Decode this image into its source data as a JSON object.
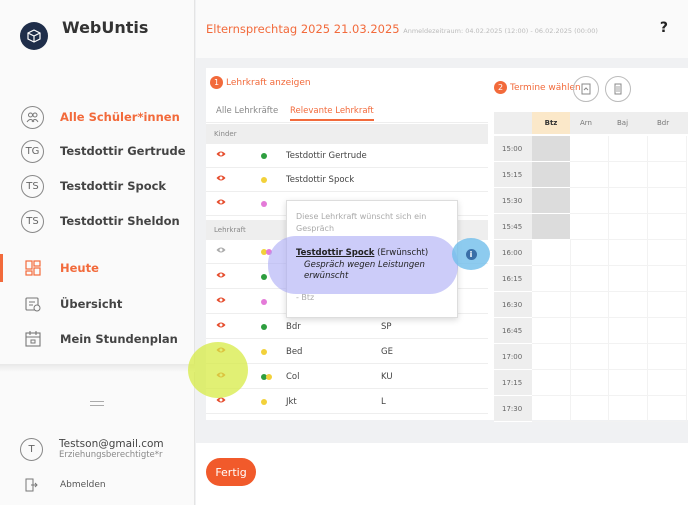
{
  "app": {
    "name": "WebUntis"
  },
  "sidebar": {
    "items": [
      {
        "label": "Alle Schüler*innen",
        "icon": "students-icon"
      },
      {
        "label": "Testdottir Gertrude",
        "initials": "TG"
      },
      {
        "label": "Testdottir Spock",
        "initials": "TS"
      },
      {
        "label": "Testdottir Sheldon",
        "initials": "TS"
      },
      {
        "label": "Heute",
        "icon": "dashboard-icon"
      },
      {
        "label": "Übersicht",
        "icon": "overview-icon"
      },
      {
        "label": "Mein Stundenplan",
        "icon": "calendar-icon"
      }
    ],
    "user": {
      "initial": "T",
      "email": "Testson@gmail.com",
      "role": "Erziehungsberechtigte*r"
    },
    "logout": "Abmelden"
  },
  "header": {
    "title": "Elternsprechtag 2025",
    "date": "21.03.2025",
    "subtitle": "Anmeldezeitraum: 04.02.2025 (12:00) - 06.02.2025 (00:00)",
    "help": "?"
  },
  "panel": {
    "step1": {
      "num": "1",
      "label": "Lehrkraft anzeigen"
    },
    "step2": {
      "num": "2",
      "label": "Termine wählen"
    },
    "tabs": [
      "Alle Lehrkräfte",
      "Relevante Lehrkraft"
    ],
    "section_kinder": "Kinder",
    "section_lehrkraft": "Lehrkraft",
    "kinder_rows": [
      {
        "name": "Testdottir Gertrude",
        "dot": "#2e9e3f"
      },
      {
        "name": "Testdottir Spock",
        "dot": "#f2d13a"
      },
      {
        "name": "",
        "dot": "#e47ad8"
      }
    ],
    "lehrer_rows": [
      {
        "c1": "",
        "c2": ""
      },
      {
        "c1": "",
        "c2": ""
      },
      {
        "c1": "",
        "c2": ""
      },
      {
        "c1": "Bdr",
        "c2": "SP"
      },
      {
        "c1": "Bed",
        "c2": "GE"
      },
      {
        "c1": "Col",
        "c2": "KU"
      },
      {
        "c1": "Jkt",
        "c2": "L"
      }
    ]
  },
  "grid": {
    "columns": [
      "Btz",
      "Arn",
      "Baj",
      "Bdr"
    ],
    "times": [
      "15:00",
      "15:15",
      "15:30",
      "15:45",
      "16:00",
      "16:15",
      "16:30",
      "16:45",
      "17:00",
      "17:15",
      "17:30"
    ]
  },
  "tooltip": {
    "hint": "Diese Lehrkraft wünscht sich ein Gespräch",
    "name": "Testdottir Spock",
    "status": "(Erwünscht)",
    "desc": "Gespräch wegen Leistungen erwünscht",
    "btz": "- Btz",
    "info": "i"
  },
  "footer": {
    "done": "Fertig"
  },
  "colors": {
    "accent": "#f26a3b",
    "dark": "#1f2e4a"
  }
}
